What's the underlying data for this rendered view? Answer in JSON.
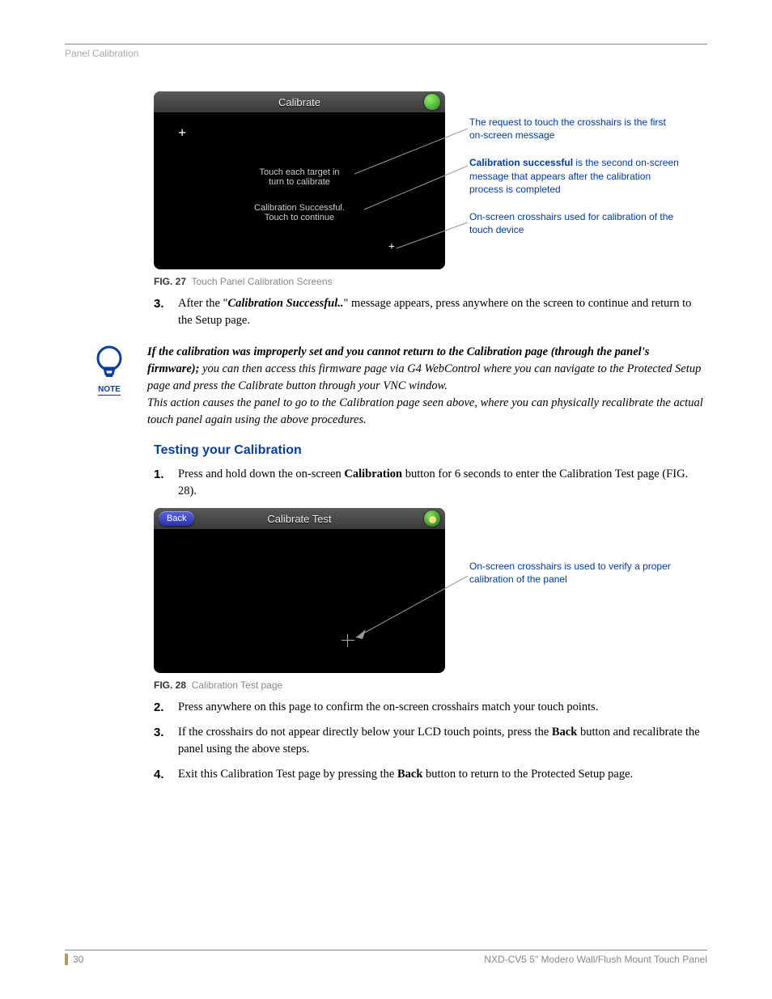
{
  "header": {
    "section": "Panel Calibration"
  },
  "fig27": {
    "title": "Calibrate",
    "line1": "Touch each target in",
    "line2": "turn to calibrate",
    "line3": "Calibration Successful.",
    "line4": "Touch to continue",
    "caption_label": "FIG. 27",
    "caption_text": "Touch Panel Calibration Screens"
  },
  "callouts27": {
    "c1": "The request to touch the crosshairs is the first on-screen message",
    "c2_bold": "Calibration successful",
    "c2_rest": " is the second on-screen message that appears after the calibration process is completed",
    "c3": "On-screen crosshairs used for calibration of the touch device"
  },
  "step3": {
    "pre": "After the \"",
    "bold": "Calibration Successful..",
    "post": "\" message appears, press anywhere on the screen to continue and return to the Setup page."
  },
  "note": {
    "label": "NOTE",
    "p1_bold": "If the calibration was improperly set and you cannot return to the Calibration page (through the panel's firmware);",
    "p1_rest": " you can then access this firmware page via G4 WebControl where you can navigate to the Protected Setup page and press the Calibrate button through your VNC window.",
    "p2": "This action causes the panel to go to the Calibration page seen above, where you can physically recalibrate the actual touch panel again using the above procedures."
  },
  "heading2": "Testing your Calibration",
  "step_b1": {
    "pre": "Press and hold down the on-screen ",
    "bold": "Calibration",
    "post": " button for 6 seconds to enter the Calibration Test page (FIG. 28)."
  },
  "fig28": {
    "title": "Calibrate Test",
    "back": "Back",
    "caption_label": "FIG. 28",
    "caption_text": "Calibration Test page"
  },
  "callouts28": {
    "c1": "On-screen crosshairs is used to verify a proper calibration of the panel"
  },
  "step_b2": "Press anywhere on this page to confirm the on-screen crosshairs match your touch points.",
  "step_b3": {
    "pre": "If the crosshairs do not appear directly below your LCD touch points, press the ",
    "bold": "Back",
    "post": " button and recalibrate the panel using the above steps."
  },
  "step_b4": {
    "pre": "Exit this Calibration Test page by pressing the ",
    "bold": "Back",
    "post": " button to return to the Protected Setup page."
  },
  "footer": {
    "page": "30",
    "doc": "NXD-CV5 5\" Modero Wall/Flush Mount Touch Panel"
  }
}
